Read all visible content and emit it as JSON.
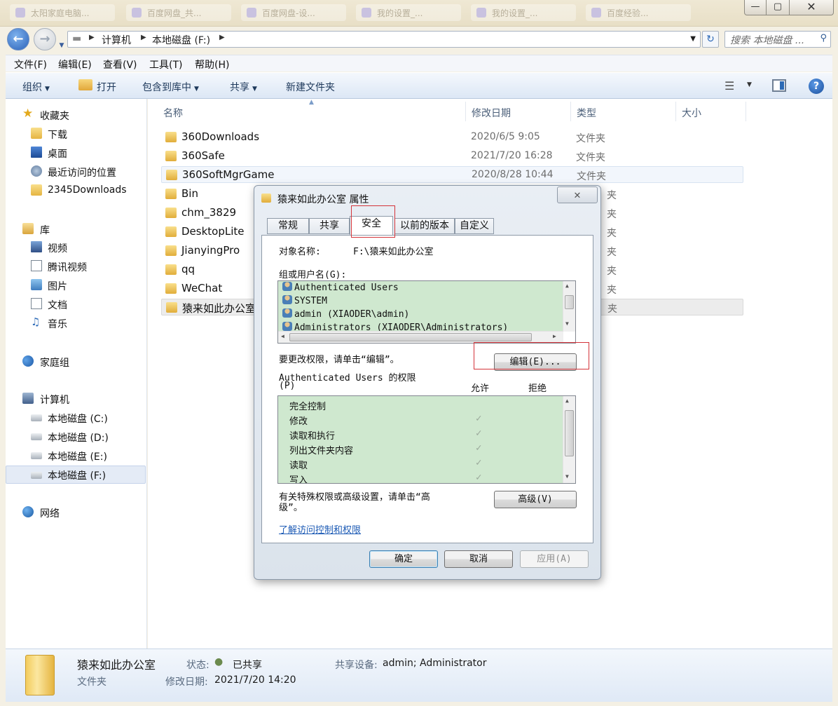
{
  "titlebar": {
    "ghost_tabs": [
      "太阳家庭电脑...",
      "百度网盘_共...",
      "百度网盘-设...",
      "我的设置_...",
      "我的设置_...",
      "百度经验..."
    ],
    "minimize": "—",
    "maximize": "▢",
    "close": "✕"
  },
  "address": {
    "crumbs": [
      "计算机",
      "本地磁盘 (F:)"
    ],
    "search_placeholder": "搜索 本地磁盘 ..."
  },
  "menu": [
    "文件(F)",
    "编辑(E)",
    "查看(V)",
    "工具(T)",
    "帮助(H)"
  ],
  "commands": {
    "organize": "组织",
    "open": "打开",
    "include_library": "包含到库中",
    "share": "共享",
    "new_folder": "新建文件夹"
  },
  "nav": {
    "favorites": "收藏夹",
    "favorites_items": [
      "下载",
      "桌面",
      "最近访问的位置",
      "2345Downloads"
    ],
    "libraries": "库",
    "library_items": [
      "视频",
      "腾讯视频",
      "图片",
      "文档",
      "音乐"
    ],
    "homegroup": "家庭组",
    "computer": "计算机",
    "drives": [
      "本地磁盘 (C:)",
      "本地磁盘 (D:)",
      "本地磁盘 (E:)",
      "本地磁盘 (F:)"
    ],
    "network": "网络"
  },
  "columns": {
    "name": "名称",
    "modified": "修改日期",
    "type": "类型",
    "size": "大小"
  },
  "files": [
    {
      "name": "360Downloads",
      "date": "2020/6/5 9:05",
      "type": "文件夹"
    },
    {
      "name": "360Safe",
      "date": "2021/7/20 16:28",
      "type": "文件夹"
    },
    {
      "name": "360SoftMgrGame",
      "date": "2020/8/28 10:44",
      "type": "文件夹"
    },
    {
      "name": "Bin",
      "date": "",
      "type": "夹"
    },
    {
      "name": "chm_3829",
      "date": "",
      "type": "夹"
    },
    {
      "name": "DesktopLite",
      "date": "",
      "type": "夹"
    },
    {
      "name": "JianyingPro",
      "date": "",
      "type": "夹"
    },
    {
      "name": "qq",
      "date": "",
      "type": "夹"
    },
    {
      "name": "WeChat",
      "date": "",
      "type": "夹"
    },
    {
      "name": "猿来如此办公室",
      "date": "",
      "type": "夹"
    }
  ],
  "details": {
    "name": "猿来如此办公室",
    "kind": "文件夹",
    "status_label": "状态:",
    "status_value": "已共享",
    "modified_label": "修改日期:",
    "modified_value": "2021/7/20 14:20",
    "shared_with_label": "共享设备:",
    "shared_with_value": "admin; Administrator"
  },
  "dialog": {
    "title": "猿来如此办公室 属性",
    "close": "✕",
    "tabs": [
      "常规",
      "共享",
      "安全",
      "以前的版本",
      "自定义"
    ],
    "object_label": "对象名称:",
    "object_value": "F:\\猿来如此办公室",
    "group_label": "组或用户名(G):",
    "users": [
      "Authenticated Users",
      "SYSTEM",
      "admin (XIAODER\\admin)",
      "Administrators (XIAODER\\Administrators)"
    ],
    "change_hint": "要更改权限，请单击“编辑”。",
    "edit_button": "编辑(E)...",
    "perm_title_line1": "Authenticated Users 的权限",
    "perm_title_line2": "(P)",
    "allow": "允许",
    "deny": "拒绝",
    "permissions": [
      "完全控制",
      "修改",
      "读取和执行",
      "列出文件夹内容",
      "读取",
      "写入"
    ],
    "permissions_allowed": [
      false,
      true,
      true,
      true,
      true,
      true
    ],
    "advanced_hint_line1": "有关特殊权限或高级设置，请单击“高",
    "advanced_hint_line2": "级”。",
    "advanced_button": "高级(V)",
    "learn_link": "了解访问控制和权限",
    "ok": "确定",
    "cancel": "取消",
    "apply": "应用(A)"
  },
  "colors": {
    "list_selection_green": "#cfe8cf",
    "highlight_red": "#d4343a",
    "link_blue": "#1d5bb5"
  }
}
